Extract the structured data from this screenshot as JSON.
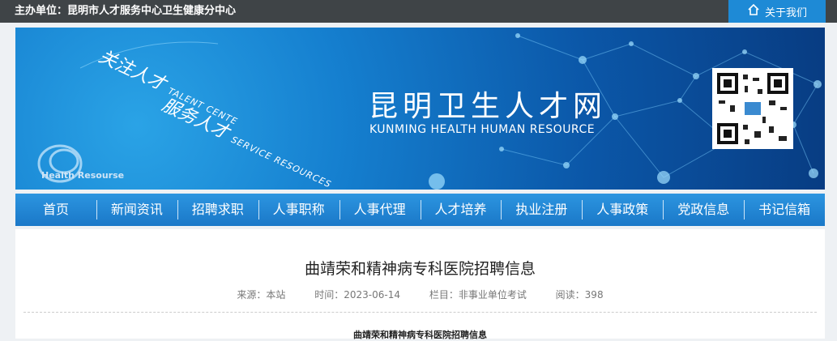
{
  "topbar": {
    "host_label": "主办单位：昆明市人才服务中心卫生健康分中心",
    "about_label": "关于我们"
  },
  "banner": {
    "slogan1": "关注人才",
    "slogan1_en": "TALENT CENTE",
    "slogan2": "服务人才",
    "slogan2_en": "SERVICE RESOURCES",
    "logo_text": "Health Resourse",
    "title": "昆明卫生人才网",
    "subtitle": "KUNMING HEALTH HUMAN RESOURCE"
  },
  "nav": {
    "items": [
      "首页",
      "新闻资讯",
      "招聘求职",
      "人事职称",
      "人事代理",
      "人才培养",
      "执业注册",
      "人事政策",
      "党政信息",
      "书记信箱"
    ]
  },
  "article": {
    "title": "曲靖荣和精神病专科医院招聘信息",
    "source": "来源：本站",
    "time": "时间：2023-06-14",
    "column": "栏目：非事业单位考试",
    "reads": "阅读：398",
    "body_title": "曲靖荣和精神病专科医院招聘信息"
  }
}
